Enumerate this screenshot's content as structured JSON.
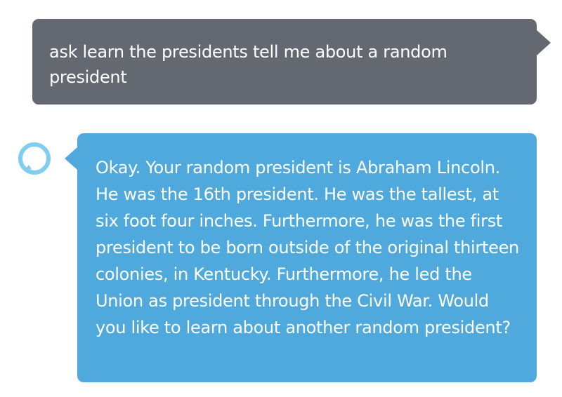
{
  "conversation": {
    "user_message": "ask learn the presidents tell me about a random president",
    "assistant_message": "Okay. Your random president is Abraham Lincoln. He was the 16th president. He was the tallest, at six foot four inches. Furthermore, he was the first president to be born outside of the original thirteen colonies, in Kentucky. Furthermore, he led the Union as president through the Civil War. Would you like to learn about another random president?"
  },
  "colors": {
    "user_bubble": "#646870",
    "assistant_bubble": "#4fa9dc",
    "alexa_ring": "#7fcef0",
    "text": "#ffffff"
  },
  "icons": {
    "assistant_avatar": "alexa-ring-icon"
  }
}
